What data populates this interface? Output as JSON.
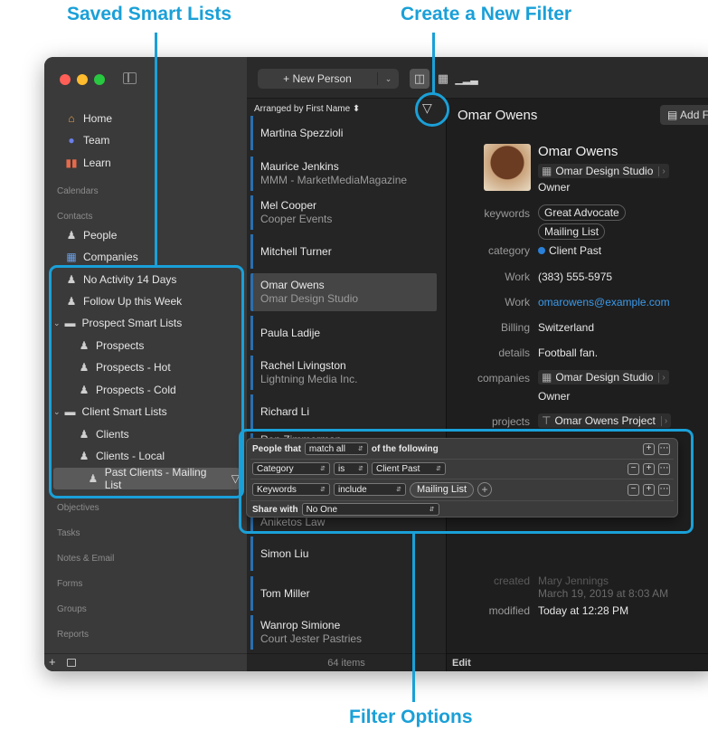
{
  "callouts": {
    "saved_smart_lists": "Saved Smart Lists",
    "create_filter": "Create a New Filter",
    "filter_options": "Filter Options"
  },
  "sidebar": {
    "items_top": [
      {
        "label": "Home",
        "icon": "house-icon"
      },
      {
        "label": "Team",
        "icon": "team-icon"
      },
      {
        "label": "Learn",
        "icon": "books-icon"
      }
    ],
    "sections": [
      "Calendars",
      "Contacts",
      "Objectives",
      "Tasks",
      "Notes & Email",
      "Forms",
      "Groups",
      "Reports"
    ],
    "contacts_items": [
      {
        "label": "People",
        "icon": "person-icon"
      },
      {
        "label": "Companies",
        "icon": "building-icon"
      }
    ],
    "smart_lists": [
      {
        "label": "No Activity 14 Days"
      },
      {
        "label": "Follow Up this Week"
      },
      {
        "label": "Prospect Smart Lists"
      },
      {
        "label": "Prospects"
      },
      {
        "label": "Prospects - Hot"
      },
      {
        "label": "Prospects - Cold"
      },
      {
        "label": "Client Smart Lists"
      },
      {
        "label": "Clients"
      },
      {
        "label": "Clients - Local"
      },
      {
        "label": "Past Clients - Mailing List"
      }
    ]
  },
  "toolbar": {
    "new_person": "+ New Person"
  },
  "list": {
    "arranged_by": "Arranged by First Name ⬍",
    "rows": [
      {
        "name": "Martina Spezzioli",
        "sub": ""
      },
      {
        "name": "Maurice Jenkins",
        "sub": "MMM - MarketMediaMagazine"
      },
      {
        "name": "Mel Cooper",
        "sub": "Cooper Events"
      },
      {
        "name": "Mitchell Turner",
        "sub": ""
      },
      {
        "name": "Omar Owens",
        "sub": "Omar Design Studio"
      },
      {
        "name": "Paula Ladije",
        "sub": ""
      },
      {
        "name": "Rachel Livingston",
        "sub": "Lightning Media Inc."
      },
      {
        "name": "Richard Li",
        "sub": ""
      },
      {
        "name": "Ron Zimmerman",
        "sub": ""
      },
      {
        "name": "",
        "sub": "Aniketos Law"
      },
      {
        "name": "Simon Liu",
        "sub": ""
      },
      {
        "name": "Tom Miller",
        "sub": ""
      },
      {
        "name": "Wanrop Simione",
        "sub": "Court Jester Pastries"
      }
    ],
    "count": "64 items"
  },
  "detail": {
    "title": "Omar Owens",
    "add_button": "Add F",
    "name": "Omar Owens",
    "company": "Omar Design Studio",
    "role": "Owner",
    "keywords_label": "keywords",
    "keywords": [
      "Great Advocate",
      "Mailing List"
    ],
    "category_label": "category",
    "category": "Client Past",
    "work_phone_label": "Work",
    "work_phone": "(383) 555-5975",
    "work_email_label": "Work",
    "work_email": "omarowens@example.com",
    "billing_label": "Billing",
    "billing": "Switzerland",
    "details_label": "details",
    "details": "Football fan.",
    "companies_label": "companies",
    "companies_name": "Omar Design Studio",
    "companies_role": "Owner",
    "projects_label": "projects",
    "projects": "Omar Owens Project",
    "created_label": "created",
    "created": "Mary Jennings",
    "created_date": "March 19, 2019 at 8:03 AM",
    "modified_label": "modified",
    "modified": "Today at 12:28 PM",
    "edit": "Edit"
  },
  "filter": {
    "people_that": "People that",
    "match": "match all",
    "of_following": "of the following",
    "rule1": {
      "field": "Category",
      "op": "is",
      "value": "Client Past"
    },
    "rule2": {
      "field": "Keywords",
      "op": "include",
      "token": "Mailing List"
    },
    "share_with_label": "Share with",
    "share_with": "No One"
  },
  "colors": {
    "accent": "#1aa0d8",
    "row_marker": "#2a6fb0"
  }
}
